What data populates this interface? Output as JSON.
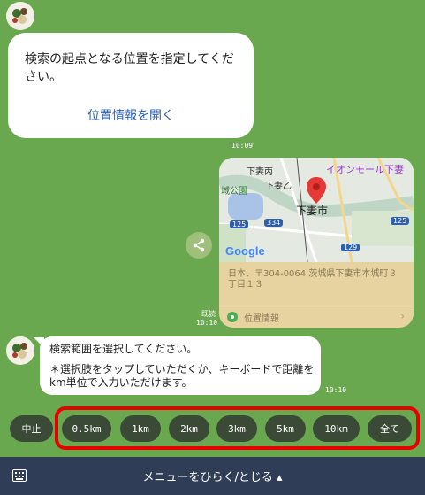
{
  "chat": {
    "msg1": {
      "text": "検索の起点となる位置を指定してください。",
      "link": "位置情報を開く",
      "time": "10:09"
    },
    "map": {
      "labels": {
        "place1": "下妻丙",
        "place2": "下妻乙",
        "city": "下妻市",
        "mall": "イオンモール下妻",
        "park": "城公園",
        "route1": "125",
        "route2": "334",
        "route3": "129",
        "route4": "125",
        "brand": "Google"
      },
      "address": "日本、〒304-0064 茨城県下妻市本城町３丁目１３",
      "location_label": "位置情報",
      "read": "既読",
      "time": "10:10"
    },
    "msg2": {
      "line1": "検索範囲を選択してください。",
      "line2": "＊選択肢をタップしていただくか、キーボードで距離をkm単位で入力いただけます。",
      "time": "10:10"
    }
  },
  "quick_replies": {
    "stop": "中止",
    "options": [
      "0.5km",
      "1km",
      "2km",
      "3km",
      "5km",
      "10km",
      "全て"
    ]
  },
  "bottom_bar": {
    "menu_label": "メニューをひらく/とじる ▴"
  },
  "colors": {
    "background": "#6aa84f",
    "chip": "#3b4a37",
    "highlight": "#e60000",
    "bottom_bar": "#2f3d56",
    "pin": "#e53935"
  }
}
